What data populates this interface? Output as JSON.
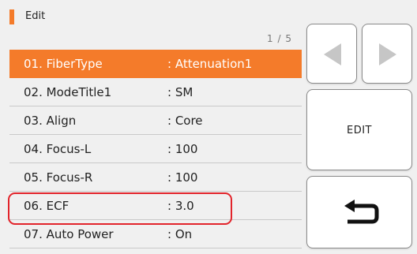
{
  "header": {
    "title": "Edit",
    "accent_color": "#f47b2a"
  },
  "pagination": {
    "indicator": "1 / 5"
  },
  "list": [
    {
      "label": "01. FiberType",
      "value": ": Attenuation1",
      "selected": true
    },
    {
      "label": "02. ModeTitle1",
      "value": ": SM",
      "selected": false
    },
    {
      "label": "03. Align",
      "value": ": Core",
      "selected": false
    },
    {
      "label": "04. Focus-L",
      "value": ": 100",
      "selected": false
    },
    {
      "label": "05. Focus-R",
      "value": ": 100",
      "selected": false
    },
    {
      "label": "06. ECF",
      "value": ": 3.0",
      "selected": false,
      "highlighted": true
    },
    {
      "label": "07. Auto Power",
      "value": ": On",
      "selected": false
    }
  ],
  "buttons": {
    "prev_icon": "triangle-left-icon",
    "next_icon": "triangle-right-icon",
    "edit_label": "EDIT",
    "back_icon": "return-arrow-icon"
  },
  "colors": {
    "selected_row": "#f47b2a",
    "highlight_border": "#e2242b",
    "arrow_disabled": "#c6c6c6"
  }
}
